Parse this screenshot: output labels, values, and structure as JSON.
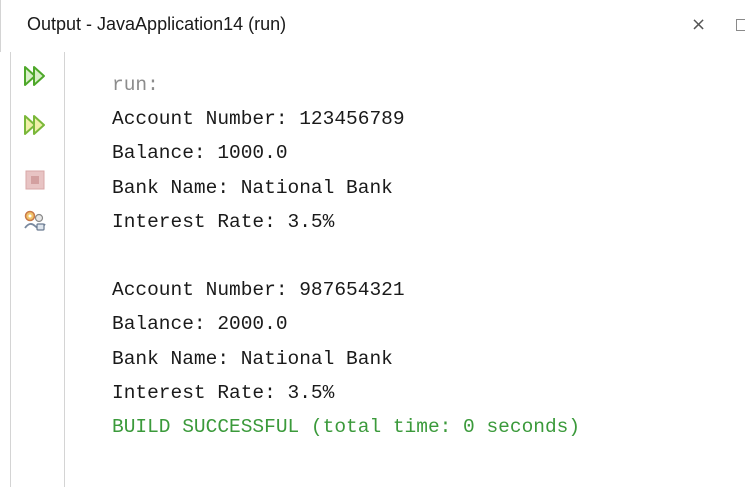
{
  "window": {
    "title": "Output - JavaApplication14 (run)",
    "close_glyph": "×"
  },
  "toolbar": {
    "buttons": [
      {
        "name": "rerun-icon",
        "color": "#4ea82a"
      },
      {
        "name": "rerun-with-options-icon",
        "color": "#4ea82a"
      },
      {
        "name": "stop-icon",
        "color": "#d9a7a7"
      },
      {
        "name": "settings-icon",
        "color": "#c97a4a"
      }
    ]
  },
  "console": {
    "lines": [
      "run:",
      "Account Number: 123456789",
      "Balance: 1000.0",
      "Bank Name: National Bank",
      "Interest Rate: 3.5%",
      "",
      "Account Number: 987654321",
      "Balance: 2000.0",
      "Bank Name: National Bank",
      "Interest Rate: 3.5%",
      "BUILD SUCCESSFUL (total time: 0 seconds)"
    ]
  }
}
